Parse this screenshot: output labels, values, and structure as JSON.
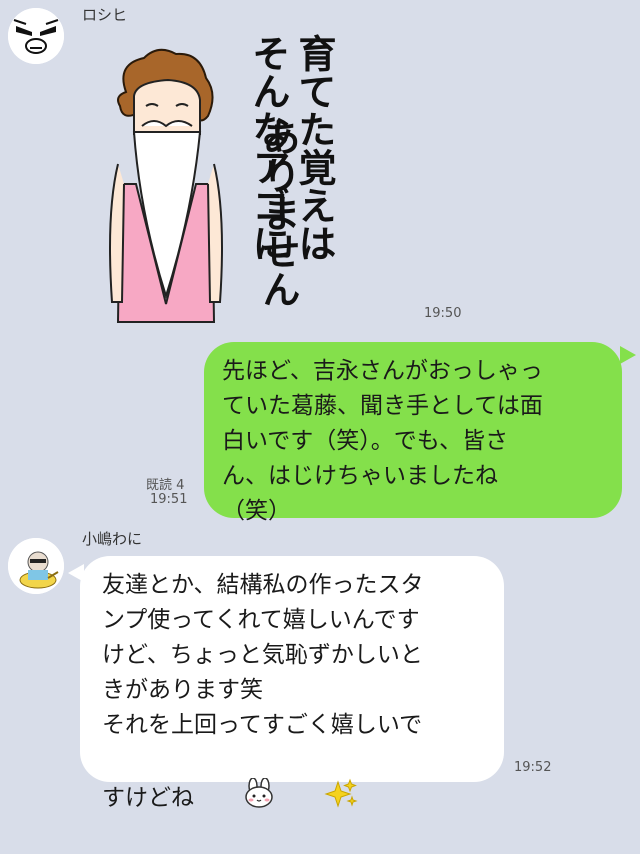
{
  "messages": [
    {
      "sender": "ロシヒ",
      "type": "sticker",
      "sticker_text_lines": [
        "そんなアゴに",
        "育てた覚えは",
        "ありません"
      ],
      "time": "19:50"
    },
    {
      "sender": "me",
      "type": "text",
      "text": "先ほど、吉永さんがおっしゃっ\nていた葛藤、聞き手としては面\n白いです（笑）。でも、皆さ\nん、はじけちゃいましたね\n（笑）",
      "read_label": "既読 4",
      "time": "19:51"
    },
    {
      "sender": "小嶋わに",
      "type": "text",
      "text": "友達とか、結構私の作ったスタ\nンプ使ってくれて嬉しいんです\nけど、ちょっと気恥ずかしいと\nきがあります笑\nそれを上回ってすごく嬉しいで\nすけどね",
      "emojis": [
        "rabbit-face-icon",
        "sparkles-icon"
      ],
      "time": "19:52"
    }
  ]
}
